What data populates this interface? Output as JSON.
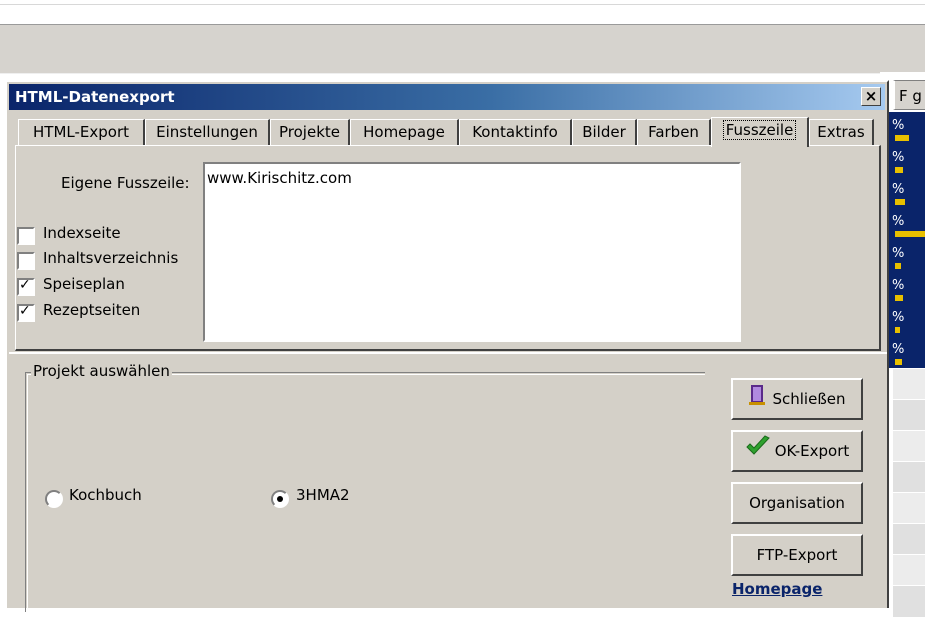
{
  "window": {
    "title": "HTML-Datenexport",
    "close_label": "×"
  },
  "tabs": [
    {
      "label": "HTML-Export"
    },
    {
      "label": "Einstellungen"
    },
    {
      "label": "Projekte"
    },
    {
      "label": "Homepage"
    },
    {
      "label": "Kontaktinfo"
    },
    {
      "label": "Bilder"
    },
    {
      "label": "Farben"
    },
    {
      "label": "Fusszeile",
      "active": true
    },
    {
      "label": "Extras"
    }
  ],
  "footer": {
    "label": "Eigene Fusszeile:",
    "text": "www.Kirischitz.com"
  },
  "checkboxes": [
    {
      "label": "Indexseite",
      "checked": false
    },
    {
      "label": "Inhaltsverzeichnis",
      "checked": false
    },
    {
      "label": "Speiseplan",
      "checked": true
    },
    {
      "label": "Rezeptseiten",
      "checked": true
    }
  ],
  "project": {
    "group_title": "Projekt auswählen",
    "options": [
      {
        "label": "Kochbuch",
        "selected": false
      },
      {
        "label": "3HMA2",
        "selected": true
      }
    ]
  },
  "buttons": {
    "close": "Schließen",
    "ok_export": "OK-Export",
    "organisation": "Organisation",
    "ftp_export": "FTP-Export",
    "homepage_link": "Homepage"
  },
  "background": {
    "column_header": "F g",
    "cell_text": "%"
  },
  "colors": {
    "title_gradient_start": "#0a246a",
    "title_gradient_end": "#a6caf0",
    "dialog_face": "#d4d0c8",
    "link": "#0a246a"
  }
}
